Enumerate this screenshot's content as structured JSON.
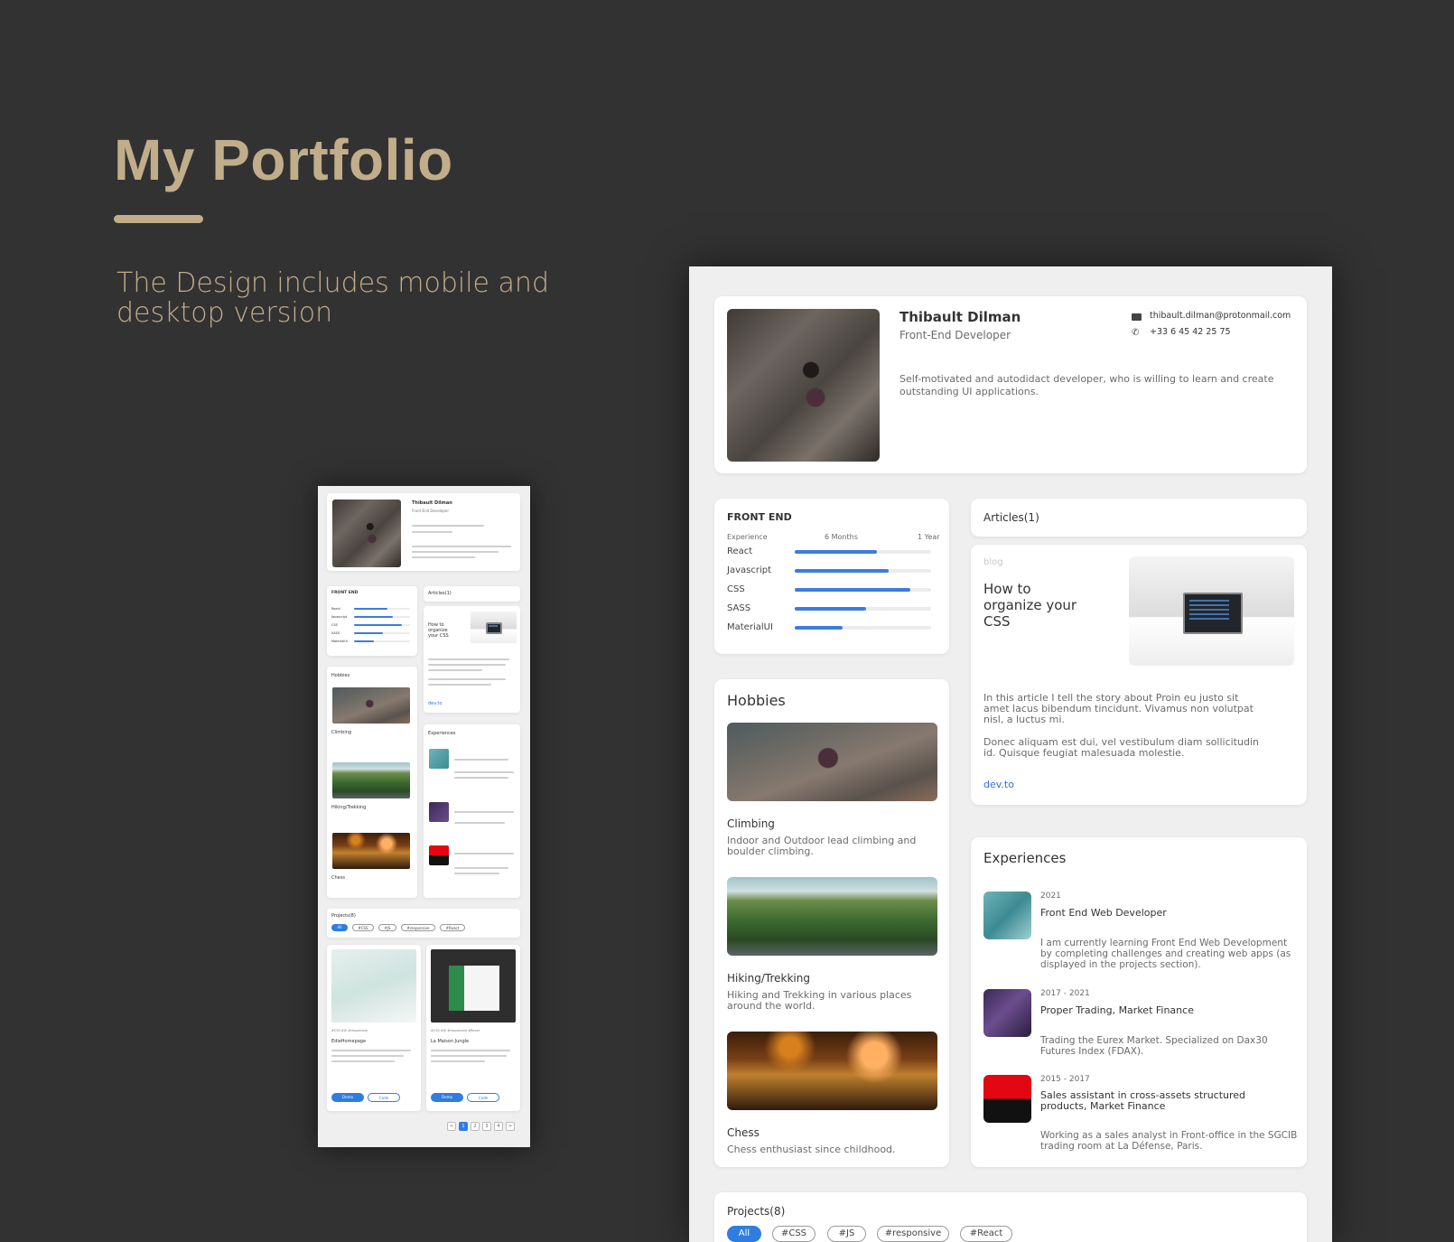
{
  "hero": {
    "title": "My Portfolio",
    "subtitle": "The Design includes mobile and desktop version",
    "accent_color": "#c2ad8a"
  },
  "profile": {
    "name": "Thibault Dilman",
    "role": "Front-End Developer",
    "email": "thibault.dilman@protonmail.com",
    "phone": "+33 6 45 42 25 75",
    "bio": "Self-motivated and autodidact developer, who is willing to learn and create outstanding UI applications.",
    "email_icon": "mail-icon",
    "phone_icon": "phone-icon"
  },
  "skills": {
    "title": "FRONT END",
    "header": {
      "label": "Experience",
      "mid": "6 Months",
      "end": "1 Year"
    },
    "items": [
      {
        "name": "React",
        "level": 0.6
      },
      {
        "name": "Javascript",
        "level": 0.69
      },
      {
        "name": "CSS",
        "level": 0.85
      },
      {
        "name": "SASS",
        "level": 0.52
      },
      {
        "name": "MaterialUI",
        "level": 0.35
      }
    ],
    "bar_color": "#3b7ddd"
  },
  "articles": {
    "title": "Articles(1)",
    "item": {
      "tag": "blog",
      "title": "How to organize your CSS",
      "body1": "In this article I tell the story about Proin eu justo sit amet lacus bibendum tincidunt. Vivamus non volutpat nisl, a luctus mi.",
      "body2": "Donec aliquam est dui, vel vestibulum diam sollicitudin id. Quisque feugiat malesuada molestie.",
      "link": "dev.to"
    }
  },
  "hobbies": {
    "title": "Hobbies",
    "items": [
      {
        "name": "Climbing",
        "desc": "Indoor and Outdoor lead climbing and boulder climbing."
      },
      {
        "name": "Hiking/Trekking",
        "desc": "Hiking and Trekking in various places around the world."
      },
      {
        "name": "Chess",
        "desc": "Chess enthusiast since childhood."
      }
    ]
  },
  "experiences": {
    "title": "Experiences",
    "items": [
      {
        "date": "2021",
        "title": "Front End Web Developer",
        "desc": "I am currently learning Front End Web Development by completing challenges and creating web apps (as displayed in the projects section)."
      },
      {
        "date": "2017 - 2021",
        "title": "Proper Trading, Market Finance",
        "desc": "Trading the Eurex Market. Specialized on Dax30 Futures Index (FDAX)."
      },
      {
        "date": "2015 - 2017",
        "title": "Sales assistant in cross-assets structured products, Market Finance",
        "desc": "Working as a sales analyst in Front-office in the SGCIB trading room at La Défense, Paris."
      }
    ]
  },
  "projects": {
    "title": "Projects(8)",
    "filters": [
      "All",
      "#CSS",
      "#JS",
      "#responsive",
      "#React"
    ],
    "active_filter": "All",
    "items": [
      {
        "tags": "#CSS  #JS  #responsive",
        "name": "EdieHomepage",
        "demo": "Demo",
        "code": "Code"
      },
      {
        "tags": "#CSS  #JS  #responsive  #React",
        "name": "La Maison Jungle",
        "demo": "Demo",
        "code": "Code"
      }
    ],
    "pages": [
      "<",
      "1",
      "2",
      "3",
      "4",
      ">"
    ]
  }
}
